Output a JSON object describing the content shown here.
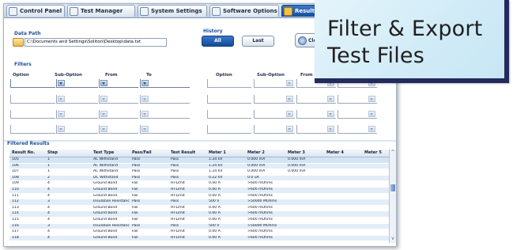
{
  "tabs": [
    {
      "label": "Control Panel",
      "icon": "control-panel-icon",
      "active": false
    },
    {
      "label": "Test Manager",
      "icon": "test-manager-icon",
      "active": false
    },
    {
      "label": "System Settings",
      "icon": "system-settings-icon",
      "active": false
    },
    {
      "label": "Software Options",
      "icon": "software-options-icon",
      "active": false
    },
    {
      "label": "Results",
      "icon": "results-icon",
      "active": true
    }
  ],
  "data_path": {
    "label": "Data Path",
    "value": "C:\\Documents and Settings\\Soliton\\Desktop\\data.txt"
  },
  "history": {
    "label": "History",
    "all_label": "All",
    "last_label": "Last",
    "clear_label": "Cle"
  },
  "filters": {
    "label": "Filters",
    "headers_left": {
      "option": "Option",
      "sub_option": "Sub-Option",
      "from": "From",
      "to": "To"
    },
    "headers_right": {
      "option": "Option",
      "sub_option": "Sub-Option",
      "from": "From"
    }
  },
  "results": {
    "label": "Filtered Results",
    "columns": [
      "Result No.",
      "Step",
      "Test Type",
      "Pass/Fail",
      "Test Result",
      "Meter 1",
      "Meter 2",
      "Meter 3",
      "Meter 4",
      "Meter 5"
    ],
    "rows": [
      [
        "105",
        "1",
        "AC Withstand",
        "Pass",
        "Pass",
        "1.24 kV",
        "0.000 mA",
        "0.000 mA",
        "",
        ""
      ],
      [
        "106",
        "1",
        "AC Withstand",
        "Pass",
        "Pass",
        "1.24 kV",
        "0.000 mA",
        "0.000 mA",
        "",
        ""
      ],
      [
        "107",
        "1",
        "AC Withstand",
        "Pass",
        "Pass",
        "1.24 kV",
        "0.000 mA",
        "0.000 mA",
        "",
        ""
      ],
      [
        "108",
        "2",
        "DC Withstand",
        "Pass",
        "Pass",
        "0.22 kV",
        "0.0 uA",
        "",
        "",
        ""
      ],
      [
        "109",
        "4",
        "Ground Bond",
        "Fail",
        "HI-Limit",
        "0.00 A",
        ">600 mOhms",
        "",
        "",
        ""
      ],
      [
        "110",
        "4",
        "Ground Bond",
        "Fail",
        "HI-Limit",
        "0.00 A",
        ">600 mOhms",
        "",
        "",
        ""
      ],
      [
        "111",
        "4",
        "Ground Bond",
        "Fail",
        "HI-Limit",
        "0.00 A",
        ">600 mOhms",
        "",
        "",
        ""
      ],
      [
        "112",
        "3",
        "Insulation Resistanc",
        "Pass",
        "Pass",
        "500 V",
        ">50000 MOhms",
        "",
        "",
        ""
      ],
      [
        "113",
        "4",
        "Ground Bond",
        "Fail",
        "HI-Limit",
        "0.00 A",
        ">600 mOhms",
        "",
        "",
        ""
      ],
      [
        "114",
        "4",
        "Ground Bond",
        "Fail",
        "HI-Limit",
        "0.00 A",
        ">600 mOhms",
        "",
        "",
        ""
      ],
      [
        "115",
        "4",
        "Ground Bond",
        "Fail",
        "HI-Limit",
        "0.00 A",
        ">600 mOhms",
        "",
        "",
        ""
      ],
      [
        "116",
        "3",
        "Insulation Resistanc",
        "Pass",
        "Pass",
        "500 V",
        ">50000 MOhms",
        "",
        "",
        ""
      ],
      [
        "117",
        "4",
        "Ground Bond",
        "Fail",
        "HI-Limit",
        "0.00 A",
        ">600 mOhms",
        "",
        "",
        ""
      ],
      [
        "118",
        "4",
        "Ground Bond",
        "Fail",
        "HI-Limit",
        "0.00 A",
        ">600 mOhms",
        "",
        "",
        ""
      ]
    ]
  },
  "callout": {
    "title": "Filter & Export Test Files"
  },
  "colors": {
    "accent": "#1d4f9b",
    "active_tab": "#164d9b",
    "callout_border": "#232a5c",
    "callout_bg": "#d2ecf7"
  }
}
